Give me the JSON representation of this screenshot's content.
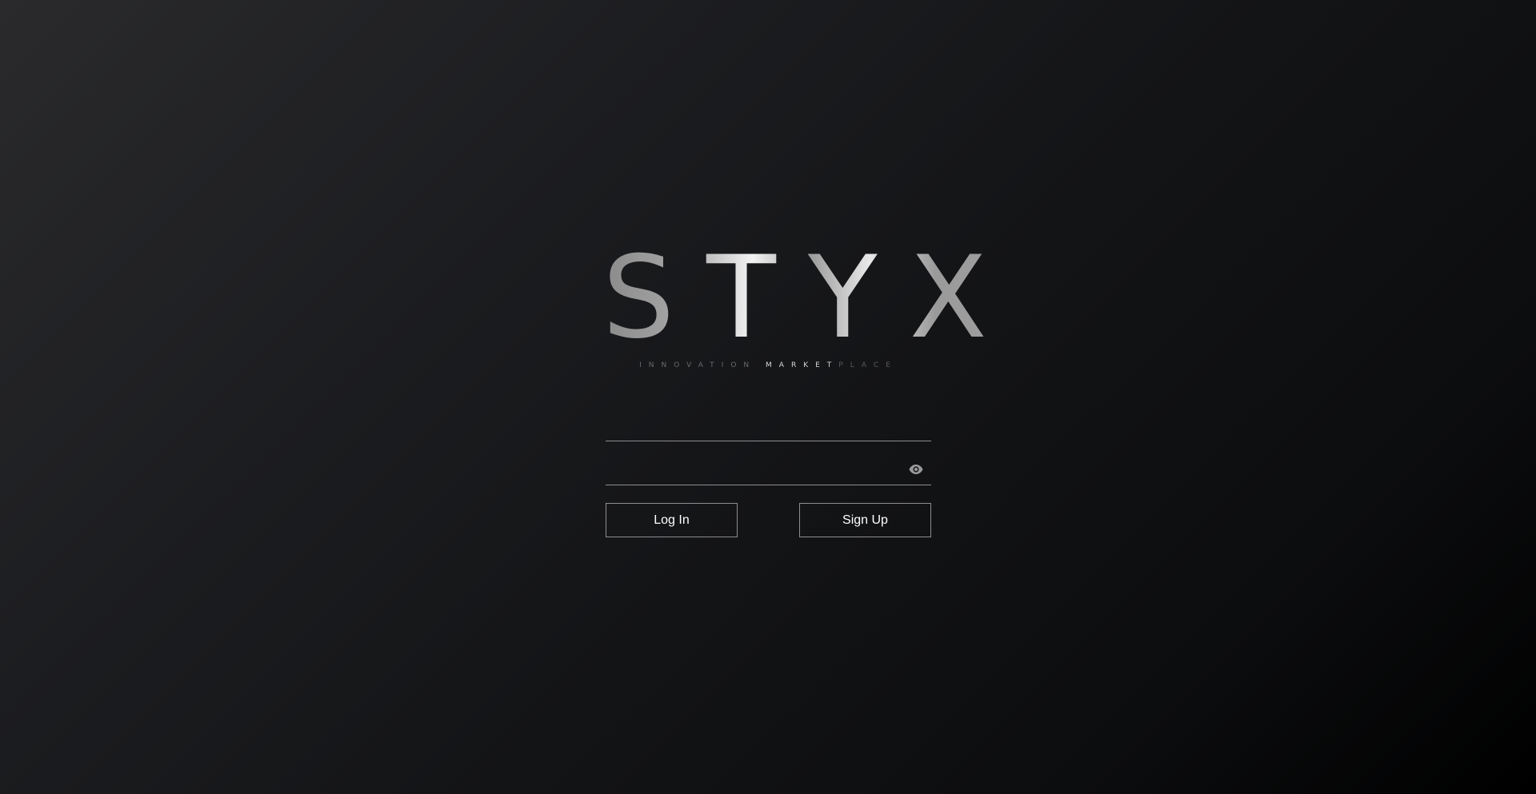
{
  "brand": {
    "name": "STYX",
    "tagline_part1": "INNOVATION ",
    "tagline_part2": "MARKET",
    "tagline_part3": "PLACE"
  },
  "form": {
    "username": {
      "value": "",
      "placeholder": ""
    },
    "password": {
      "value": "",
      "placeholder": "",
      "toggle_icon": "eye-icon"
    },
    "login_label": "Log In",
    "signup_label": "Sign Up"
  },
  "colors": {
    "background_start": "#2a2a2c",
    "background_end": "#000000",
    "border": "#8e8e90",
    "text": "#ffffff"
  }
}
